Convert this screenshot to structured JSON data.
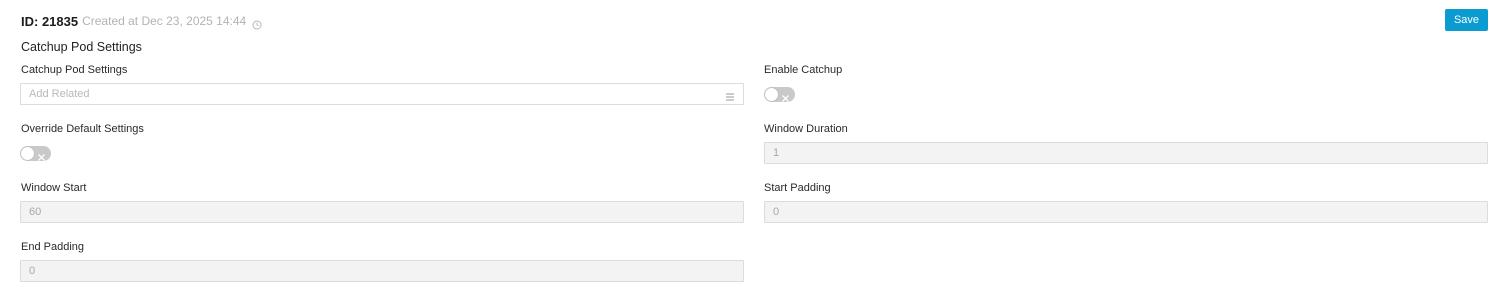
{
  "header": {
    "record_id": "ID: 21835",
    "created_text": "Created at Dec 23, 2025 14:44",
    "clock_icon": "clock-icon",
    "save_label": "Save"
  },
  "section": {
    "title": "Catchup Pod Settings"
  },
  "fields": {
    "catchup_pod_settings": {
      "label": "Catchup Pod Settings",
      "placeholder": "Add Related",
      "icon": "list-icon"
    },
    "enable_catchup": {
      "label": "Enable Catchup",
      "enabled": false
    },
    "override_default_settings": {
      "label": "Override Default Settings",
      "enabled": false
    },
    "window_duration": {
      "label": "Window Duration",
      "value": "1"
    },
    "window_start": {
      "label": "Window Start",
      "value": "60"
    },
    "start_padding": {
      "label": "Start Padding",
      "value": "0"
    },
    "end_padding": {
      "label": "End Padding",
      "value": "0"
    }
  },
  "colors": {
    "accent": "#0a9bd1",
    "toggle_off": "#c9c9c9",
    "input_disabled_bg": "#f3f3f3"
  }
}
